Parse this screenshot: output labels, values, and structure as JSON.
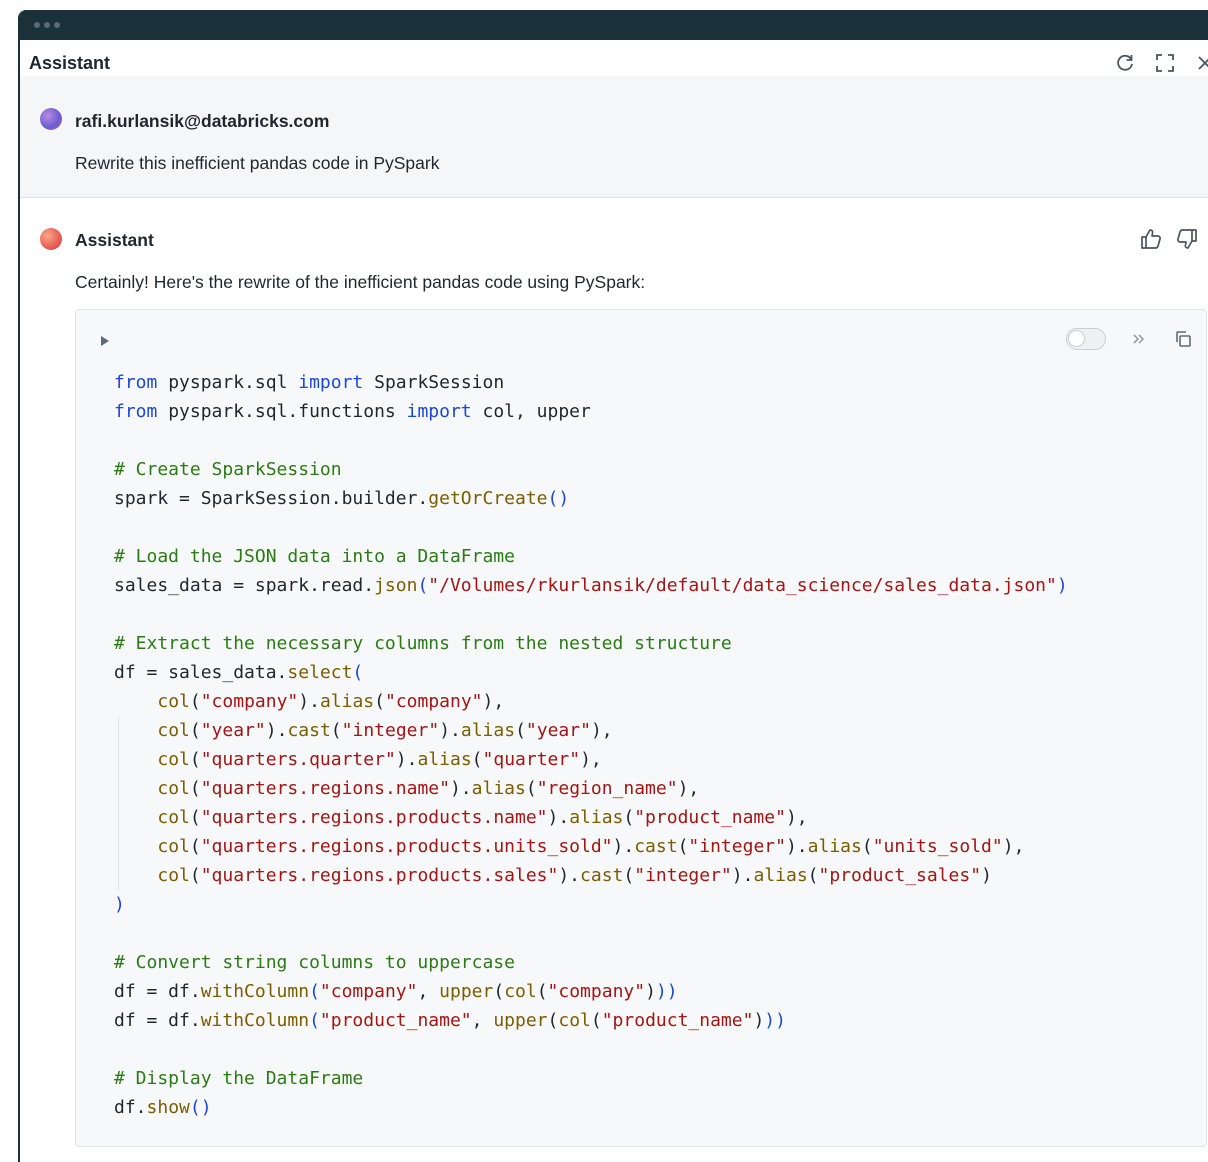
{
  "header": {
    "title": "Assistant",
    "icons": [
      "refresh-icon",
      "expand-icon",
      "close-icon"
    ]
  },
  "user_message": {
    "author": "rafi.kurlansik@databricks.com",
    "text": "Rewrite this inefficient pandas code in PySpark"
  },
  "assistant_message": {
    "author": "Assistant",
    "text": "Certainly! Here's the rewrite of the inefficient pandas code using PySpark:",
    "feedback_icons": [
      "thumbs-up-icon",
      "thumbs-down-icon"
    ]
  },
  "code": {
    "language": "python",
    "lines": [
      [
        [
          "kw",
          "from"
        ],
        [
          "t",
          " pyspark.sql "
        ],
        [
          "kw",
          "import"
        ],
        [
          "t",
          " SparkSession"
        ]
      ],
      [
        [
          "kw",
          "from"
        ],
        [
          "t",
          " pyspark.sql.functions "
        ],
        [
          "kw",
          "import"
        ],
        [
          "t",
          " col, upper"
        ]
      ],
      [],
      [
        [
          "cm",
          "# Create SparkSession"
        ]
      ],
      [
        [
          "t",
          "spark = SparkSession.builder."
        ],
        [
          "fn",
          "getOrCreate"
        ],
        [
          "br",
          "()"
        ]
      ],
      [],
      [
        [
          "cm",
          "# Load the JSON data into a DataFrame"
        ]
      ],
      [
        [
          "t",
          "sales_data = spark.read."
        ],
        [
          "fn",
          "json"
        ],
        [
          "br",
          "("
        ],
        [
          "st",
          "\"/Volumes/rkurlansik/default/data_science/sales_data.json\""
        ],
        [
          "br",
          ")"
        ]
      ],
      [],
      [
        [
          "cm",
          "# Extract the necessary columns from the nested structure"
        ]
      ],
      [
        [
          "t",
          "df = sales_data."
        ],
        [
          "fn",
          "select"
        ],
        [
          "br",
          "("
        ]
      ],
      [
        [
          "t",
          "    "
        ],
        [
          "fn",
          "col"
        ],
        [
          "t",
          "("
        ],
        [
          "st",
          "\"company\""
        ],
        [
          "t",
          ")."
        ],
        [
          "fn",
          "alias"
        ],
        [
          "t",
          "("
        ],
        [
          "st",
          "\"company\""
        ],
        [
          "t",
          "),"
        ]
      ],
      [
        [
          "t",
          "    "
        ],
        [
          "fn",
          "col"
        ],
        [
          "t",
          "("
        ],
        [
          "st",
          "\"year\""
        ],
        [
          "t",
          ")."
        ],
        [
          "fn",
          "cast"
        ],
        [
          "t",
          "("
        ],
        [
          "st",
          "\"integer\""
        ],
        [
          "t",
          ")."
        ],
        [
          "fn",
          "alias"
        ],
        [
          "t",
          "("
        ],
        [
          "st",
          "\"year\""
        ],
        [
          "t",
          "),"
        ]
      ],
      [
        [
          "t",
          "    "
        ],
        [
          "fn",
          "col"
        ],
        [
          "t",
          "("
        ],
        [
          "st",
          "\"quarters.quarter\""
        ],
        [
          "t",
          ")."
        ],
        [
          "fn",
          "alias"
        ],
        [
          "t",
          "("
        ],
        [
          "st",
          "\"quarter\""
        ],
        [
          "t",
          "),"
        ]
      ],
      [
        [
          "t",
          "    "
        ],
        [
          "fn",
          "col"
        ],
        [
          "t",
          "("
        ],
        [
          "st",
          "\"quarters.regions.name\""
        ],
        [
          "t",
          ")."
        ],
        [
          "fn",
          "alias"
        ],
        [
          "t",
          "("
        ],
        [
          "st",
          "\"region_name\""
        ],
        [
          "t",
          "),"
        ]
      ],
      [
        [
          "t",
          "    "
        ],
        [
          "fn",
          "col"
        ],
        [
          "t",
          "("
        ],
        [
          "st",
          "\"quarters.regions.products.name\""
        ],
        [
          "t",
          ")."
        ],
        [
          "fn",
          "alias"
        ],
        [
          "t",
          "("
        ],
        [
          "st",
          "\"product_name\""
        ],
        [
          "t",
          "),"
        ]
      ],
      [
        [
          "t",
          "    "
        ],
        [
          "fn",
          "col"
        ],
        [
          "t",
          "("
        ],
        [
          "st",
          "\"quarters.regions.products.units_sold\""
        ],
        [
          "t",
          ")."
        ],
        [
          "fn",
          "cast"
        ],
        [
          "t",
          "("
        ],
        [
          "st",
          "\"integer\""
        ],
        [
          "t",
          ")."
        ],
        [
          "fn",
          "alias"
        ],
        [
          "t",
          "("
        ],
        [
          "st",
          "\"units_sold\""
        ],
        [
          "t",
          "),"
        ]
      ],
      [
        [
          "t",
          "    "
        ],
        [
          "fn",
          "col"
        ],
        [
          "t",
          "("
        ],
        [
          "st",
          "\"quarters.regions.products.sales\""
        ],
        [
          "t",
          ")."
        ],
        [
          "fn",
          "cast"
        ],
        [
          "t",
          "("
        ],
        [
          "st",
          "\"integer\""
        ],
        [
          "t",
          ")."
        ],
        [
          "fn",
          "alias"
        ],
        [
          "t",
          "("
        ],
        [
          "st",
          "\"product_sales\""
        ],
        [
          "t",
          ")"
        ]
      ],
      [
        [
          "br",
          ")"
        ]
      ],
      [],
      [
        [
          "cm",
          "# Convert string columns to uppercase"
        ]
      ],
      [
        [
          "t",
          "df = df."
        ],
        [
          "fn",
          "withColumn"
        ],
        [
          "br",
          "("
        ],
        [
          "st",
          "\"company\""
        ],
        [
          "t",
          ", "
        ],
        [
          "fn",
          "upper"
        ],
        [
          "t",
          "("
        ],
        [
          "fn",
          "col"
        ],
        [
          "t",
          "("
        ],
        [
          "st",
          "\"company\""
        ],
        [
          "t",
          ")"
        ],
        [
          "br",
          "))"
        ]
      ],
      [
        [
          "t",
          "df = df."
        ],
        [
          "fn",
          "withColumn"
        ],
        [
          "br",
          "("
        ],
        [
          "st",
          "\"product_name\""
        ],
        [
          "t",
          ", "
        ],
        [
          "fn",
          "upper"
        ],
        [
          "t",
          "("
        ],
        [
          "fn",
          "col"
        ],
        [
          "t",
          "("
        ],
        [
          "st",
          "\"product_name\""
        ],
        [
          "t",
          ")"
        ],
        [
          "br",
          "))"
        ]
      ],
      [],
      [
        [
          "cm",
          "# Display the DataFrame"
        ]
      ],
      [
        [
          "t",
          "df."
        ],
        [
          "fn",
          "show"
        ],
        [
          "br",
          "()"
        ]
      ]
    ]
  },
  "colors": {
    "titlebar": "#1b3139",
    "keyword": "#1c47d8",
    "comment": "#2a7b15",
    "string": "#a31515",
    "function": "#7a5d00"
  }
}
